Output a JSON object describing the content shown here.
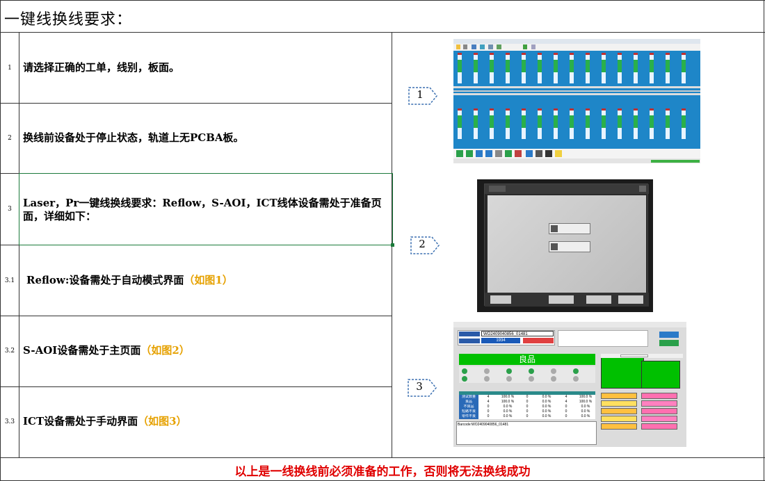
{
  "title": "一键线换线要求：",
  "rows": [
    {
      "num": "1",
      "text": "请选择正确的工单，线别，板面。"
    },
    {
      "num": "2",
      "text": "换线前设备处于停止状态，轨道上无PCBA板。"
    },
    {
      "num": "3",
      "text": "Laser，Pr一键线换线要求：Reflow，S-AOI，ICT线体设备需处于准备页面，详细如下："
    },
    {
      "num": "3.1",
      "text": " Reflow:设备需处于自动模式界面",
      "hint": "（如图1）"
    },
    {
      "num": "3.2",
      "text": "S-AOI设备需处于主页面",
      "hint": "（如图2）"
    },
    {
      "num": "3.3",
      "text": "ICT设备需处于手动界面",
      "hint": "（如图3）"
    }
  ],
  "callouts": [
    "1",
    "2",
    "3"
  ],
  "footer": "以上是一线换线前必须准备的工作，否则将无法换线成功",
  "screens": {
    "ict": {
      "barcode_value": "WO2409040856_01481",
      "count_value": "1934",
      "result_label": "良品",
      "barcode_line": "Barcode:WO2409040856_01481",
      "table_rows": [
        [
          "测试数量",
          "4",
          "100.0 %",
          "0",
          "0.0 %",
          "4",
          "100.0 %"
        ],
        [
          "良品",
          "4",
          "100.0 %",
          "0",
          "0.0 %",
          "4",
          "100.0 %"
        ],
        [
          "不良品",
          "0",
          "0.0 %",
          "0",
          "0.0 %",
          "0",
          "0.0 %"
        ],
        [
          "短路不良",
          "0",
          "0.0 %",
          "0",
          "0.0 %",
          "0",
          "0.0 %"
        ],
        [
          "零件不良",
          "0",
          "0.0 %",
          "0",
          "0.0 %",
          "0",
          "0.0 %"
        ]
      ]
    }
  },
  "colors": {
    "footer_text": "#e00000",
    "hint_text": "#e6a100",
    "selected_border": "#1a7a3a",
    "reflow_bg": "#1e86c8",
    "ict_green": "#00c000"
  }
}
